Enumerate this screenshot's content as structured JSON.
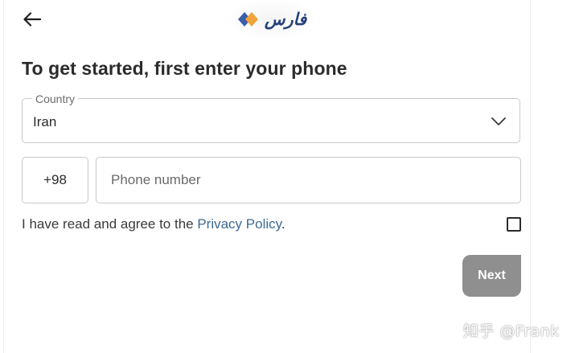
{
  "header": {
    "back_icon": "arrow-left-icon",
    "logo_text": "فارس",
    "logo_colors": {
      "blue": "#3b5ea8",
      "orange": "#f2a33a",
      "text": "#24407a"
    }
  },
  "title": "To get started, first enter your phone",
  "country": {
    "label": "Country",
    "value": "Iran",
    "icon": "chevron-down-icon"
  },
  "phone": {
    "code": "+98",
    "placeholder": "Phone number",
    "value": ""
  },
  "privacy": {
    "text": "I have read and agree to the ",
    "link": "Privacy Policy",
    "suffix": ".",
    "checked": false,
    "link_color": "#3d6a93"
  },
  "next_button": {
    "label": "Next",
    "color": "#8f8f8f",
    "enabled": false
  },
  "watermark": "知乎 @Frank"
}
